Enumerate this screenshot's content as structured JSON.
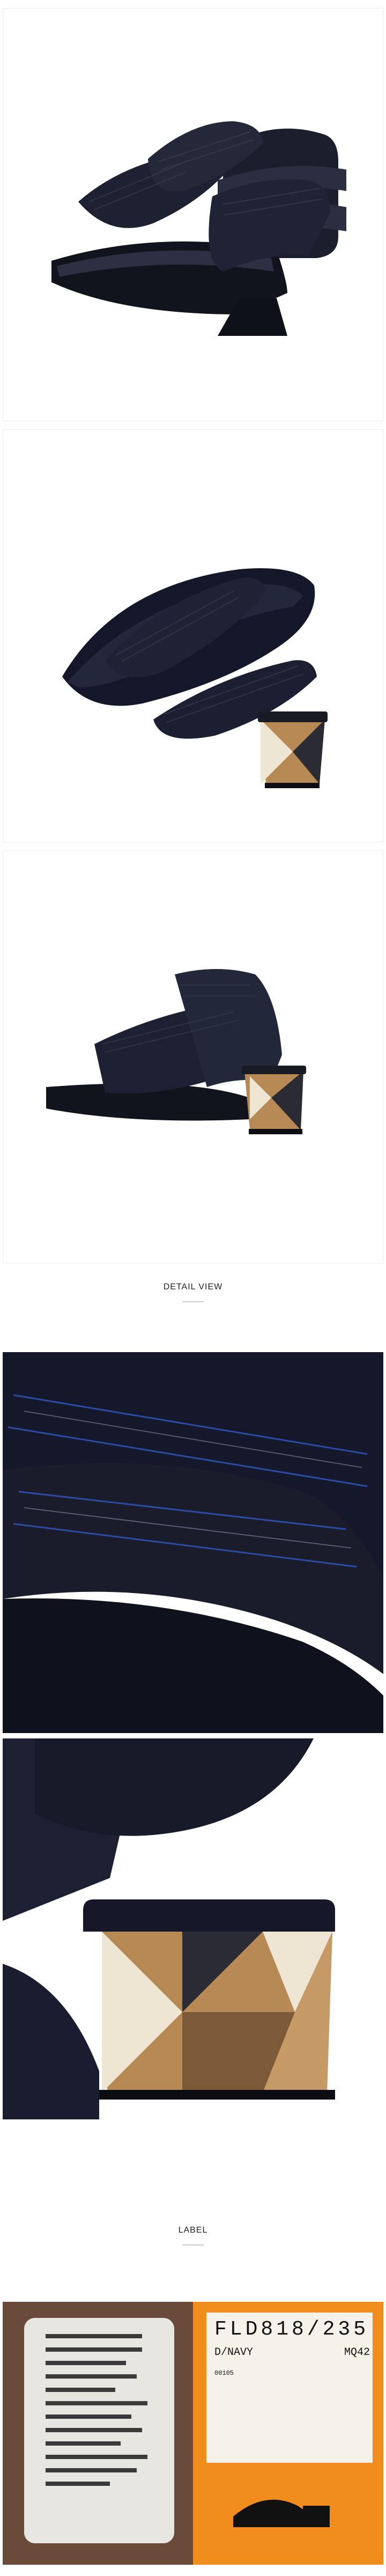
{
  "sections": {
    "detail_heading": "DETAIL VIEW",
    "label_heading": "LABEL"
  },
  "label_card": {
    "lines": [
      "원산지 및 소재",
      "제조연월",
      "품명 및 모델명",
      "사이즈",
      "색상",
      "가격",
      "판매원",
      "제조국",
      "A/S 책임자"
    ],
    "lines_note": "Small Korean care/spec label text (illegible at this resolution)"
  },
  "tag": {
    "code": "FLD818/235",
    "color": "D/NAVY",
    "model": "MQ42",
    "small_text": "00105"
  },
  "colors": {
    "navy": "#15182a",
    "heel_tan": "#b78a55",
    "heel_cream": "#eee6d2",
    "heel_dark": "#2b2c33",
    "orange": "#f08d1c"
  }
}
